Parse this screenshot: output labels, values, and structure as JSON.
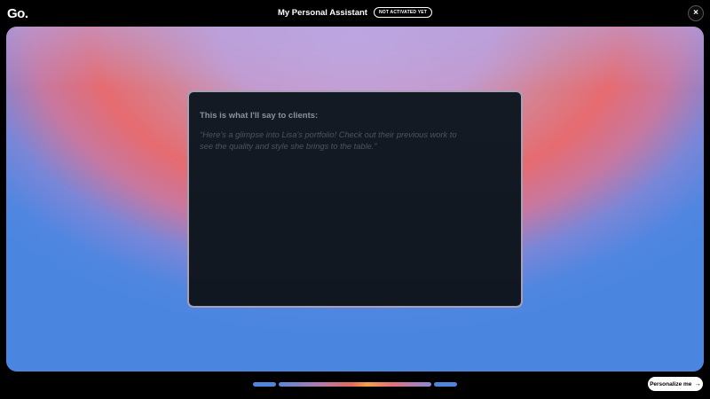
{
  "header": {
    "logo": "Go.",
    "title": "My Personal Assistant",
    "badge": "NOT ACTIVATED YET",
    "close_icon": "×"
  },
  "card": {
    "heading": "This is what I'll say to clients:",
    "quote": "“Here’s a glimpse into Lisa’s portfolio! Check out their previous work to see the quality and style she brings to the table.”"
  },
  "progress": {
    "segments": 3,
    "active_segment": 2
  },
  "footer": {
    "cta_label": "Personalize me",
    "cta_icon": "→"
  },
  "colors": {
    "background": "#000000",
    "card": "#131923",
    "accent_blue": "#4f86db",
    "accent_red": "#e66b70",
    "accent_lavender": "#c2a6dc"
  }
}
